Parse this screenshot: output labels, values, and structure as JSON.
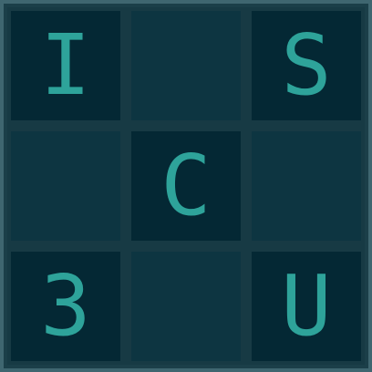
{
  "board": {
    "cells": [
      {
        "row": 0,
        "col": 0,
        "value": "I"
      },
      {
        "row": 0,
        "col": 1,
        "value": ""
      },
      {
        "row": 0,
        "col": 2,
        "value": "S"
      },
      {
        "row": 1,
        "col": 0,
        "value": ""
      },
      {
        "row": 1,
        "col": 1,
        "value": "C"
      },
      {
        "row": 1,
        "col": 2,
        "value": ""
      },
      {
        "row": 2,
        "col": 0,
        "value": "3"
      },
      {
        "row": 2,
        "col": 1,
        "value": ""
      },
      {
        "row": 2,
        "col": 2,
        "value": "U"
      }
    ]
  },
  "colors": {
    "board_background": "#1b3f49",
    "border": "#3f6670",
    "cell_filled": "#042834",
    "cell_empty": "#0d3541",
    "text": "#2ea39a"
  }
}
